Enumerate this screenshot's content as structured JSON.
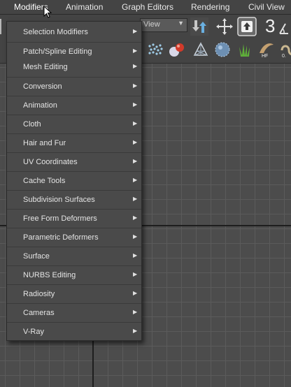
{
  "menubar": {
    "items": [
      {
        "label": "Modifiers",
        "active": true
      },
      {
        "label": "Animation"
      },
      {
        "label": "Graph Editors"
      },
      {
        "label": "Rendering"
      },
      {
        "label": "Civil View"
      }
    ]
  },
  "toolbar": {
    "view_select": "View",
    "number_label": "3"
  },
  "modifiers_menu": {
    "items": [
      {
        "label": "Selection Modifiers",
        "submenu": true
      },
      {
        "label": "Patch/Spline Editing",
        "submenu": true
      },
      {
        "label": "Mesh Editing",
        "submenu": true
      },
      {
        "label": "Conversion",
        "submenu": true
      },
      {
        "label": "Animation",
        "submenu": true
      },
      {
        "label": "Cloth",
        "submenu": true
      },
      {
        "label": "Hair and Fur",
        "submenu": true
      },
      {
        "label": "UV Coordinates",
        "submenu": true
      },
      {
        "label": "Cache Tools",
        "submenu": true
      },
      {
        "label": "Subdivision Surfaces",
        "submenu": true
      },
      {
        "label": "Free Form Deformers",
        "submenu": true
      },
      {
        "label": "Parametric Deformers",
        "submenu": true
      },
      {
        "label": "Surface",
        "submenu": true
      },
      {
        "label": "NURBS Editing",
        "submenu": true
      },
      {
        "label": "Radiosity",
        "submenu": true
      },
      {
        "label": "Cameras",
        "submenu": true
      },
      {
        "label": "V-Ray",
        "submenu": true
      }
    ]
  },
  "icons": {
    "toolbar_row1": [
      "move-arrows-icon",
      "crosshair-move-icon",
      "select-up-icon",
      "number-3-icon",
      "angle-snap-icon"
    ],
    "toolbar_row2": [
      "particles-icon",
      "material-sphere-icon",
      "geometry-icon",
      "dotted-sphere-icon",
      "grass-icon",
      "hair-fur-icon",
      "infinity-icon"
    ]
  },
  "colors": {
    "menubar_bg": "#444444",
    "menu_bg": "#4a4a4a",
    "viewport_bg": "#4c4c4c",
    "text": "#e4e4e4"
  }
}
